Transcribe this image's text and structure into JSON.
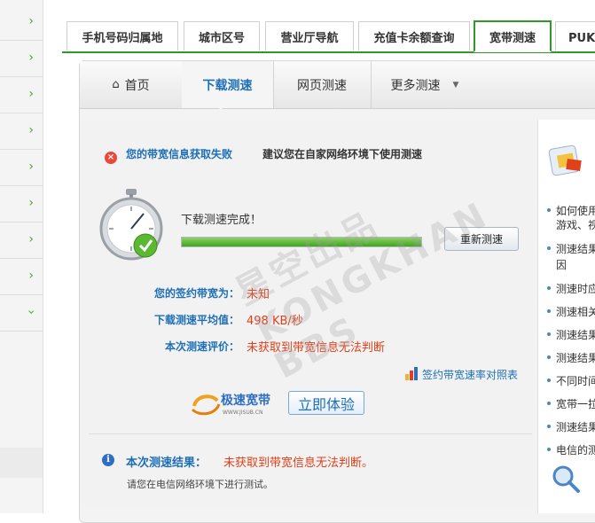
{
  "carrier_tabs": [
    "手机号码归属地",
    "城市区号",
    "营业厅导航",
    "充值卡余额查询",
    "宽带测速",
    "PUK码"
  ],
  "sub_nav": {
    "home": "首页",
    "download": "下载测速",
    "web": "网页测速",
    "more": "更多测速"
  },
  "status": {
    "fail": "您的带宽信息获取失败",
    "advice": "建议您在自家网络环境下使用测速"
  },
  "test": {
    "complete": "下载测速完成！",
    "progress": 100,
    "retest": "重新测速"
  },
  "results": {
    "bandwidth_label": "您的签约带宽为：",
    "bandwidth_value": "未知",
    "avg_label": "下载测速平均值：",
    "avg_value": "498 KB/秒",
    "eval_label": "本次测速评价：",
    "eval_value": "未获取到带宽信息无法判断"
  },
  "compare_link": "签约带宽速率对照表",
  "promo": {
    "logo_text": "极速宽带",
    "logo_sub": "WWW.JISUB.CN",
    "try_button": "立即体验"
  },
  "summary": {
    "label": "本次测速结果：",
    "value": "未获取到带宽信息无法判断。",
    "hint": "请您在电信网络环境下进行测试。"
  },
  "watermark": "星空出品 KONGKHAN BBS",
  "right_items": [
    "如何使用",
    "游戏、视",
    "测速结果",
    "因",
    "测速时应",
    "测速相关",
    "测速结果",
    "测速结果",
    "不同时间",
    "宽带一拉",
    "测速结果",
    "电信的测"
  ],
  "colors": {
    "accent_green": "#2f9a27",
    "link_blue": "#1e6fb5",
    "warn_red": "#e0401a"
  }
}
